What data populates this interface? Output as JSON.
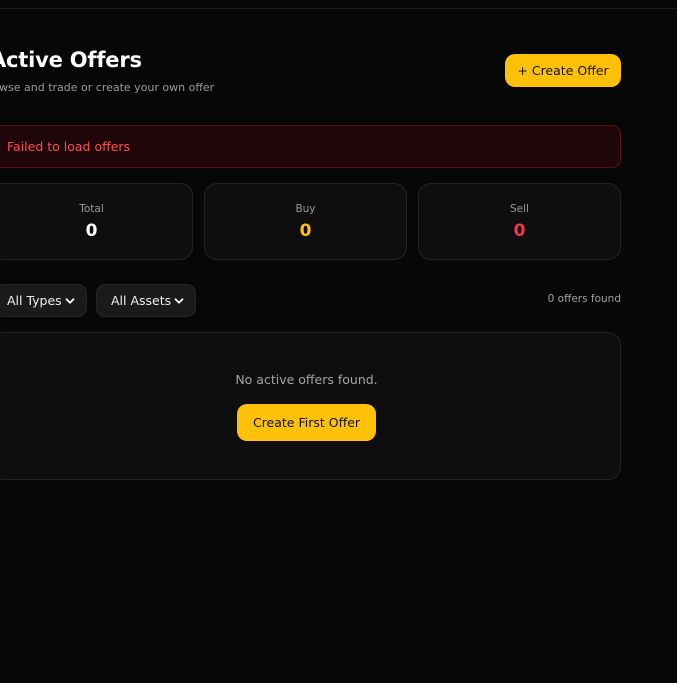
{
  "header": {
    "title": "Active Offers",
    "subtitle": "rowse and trade or create your own offer",
    "create_button": {
      "icon": "+",
      "label": "Create Offer"
    }
  },
  "error": {
    "message": "Failed to load offers"
  },
  "stats": {
    "total": {
      "label": "Total",
      "value": "0"
    },
    "buy": {
      "label": "Buy",
      "value": "0"
    },
    "sell": {
      "label": "Sell",
      "value": "0"
    }
  },
  "filters": {
    "type": {
      "selected": "All Types"
    },
    "asset": {
      "selected": "All Assets"
    },
    "count_text": "0 offers found"
  },
  "empty_state": {
    "message": "No active offers found.",
    "button_label": "Create First Offer"
  },
  "icons": {
    "dropdown": "chevron-down-icon",
    "add": "plus-icon"
  },
  "colors": {
    "accent": "#ffc107",
    "error": "#ff4d57",
    "sell": "#ff3344",
    "background": "#070707",
    "card": "#0e0e0e"
  }
}
